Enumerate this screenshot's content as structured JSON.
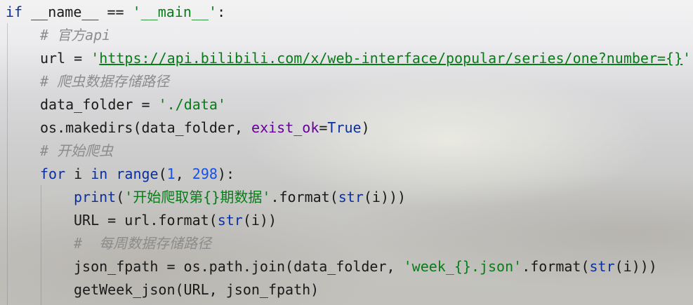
{
  "code": {
    "l1": {
      "kw_if": "if",
      "cond": " __name__ == ",
      "str_main": "'__main__'",
      "colon": ":"
    },
    "l2": {
      "comment": "# 官方api"
    },
    "l3": {
      "lhs": "url = ",
      "q1": "'",
      "url": "https://api.bilibili.com/x/web-interface/popular/series/one?number={}",
      "q2": "'"
    },
    "l4": {
      "comment": "# 爬虫数据存储路径"
    },
    "l5": {
      "lhs": "data_folder = ",
      "str": "'./data'"
    },
    "l6": {
      "call": "os.makedirs(data_folder, ",
      "kwarg": "exist_ok",
      "eq": "=",
      "val": "True",
      "close": ")"
    },
    "l7": {
      "comment": "# 开始爬虫"
    },
    "l8": {
      "kw_for": "for",
      "i": " i ",
      "kw_in": "in",
      "sp": " ",
      "range": "range",
      "open": "(",
      "n1": "1",
      "comma": ", ",
      "n2": "298",
      "close": "):"
    },
    "l9": {
      "print": "print",
      "open": "(",
      "str": "'开始爬取第{}期数据'",
      "fmt": ".format(",
      "str_fn": "str",
      "rest": "(i)))"
    },
    "l10": {
      "lhs": "URL = url.format(",
      "str_fn": "str",
      "rest": "(i))"
    },
    "l11": {
      "comment": "#  每周数据存储路径"
    },
    "l12": {
      "lhs": "json_fpath = os.path.join(data_folder, ",
      "str": "'week_{}.json'",
      "fmt": ".format(",
      "str_fn": "str",
      "rest": "(i)))"
    },
    "l13": {
      "call": "getWeek_json(URL, json_fpath)"
    }
  }
}
